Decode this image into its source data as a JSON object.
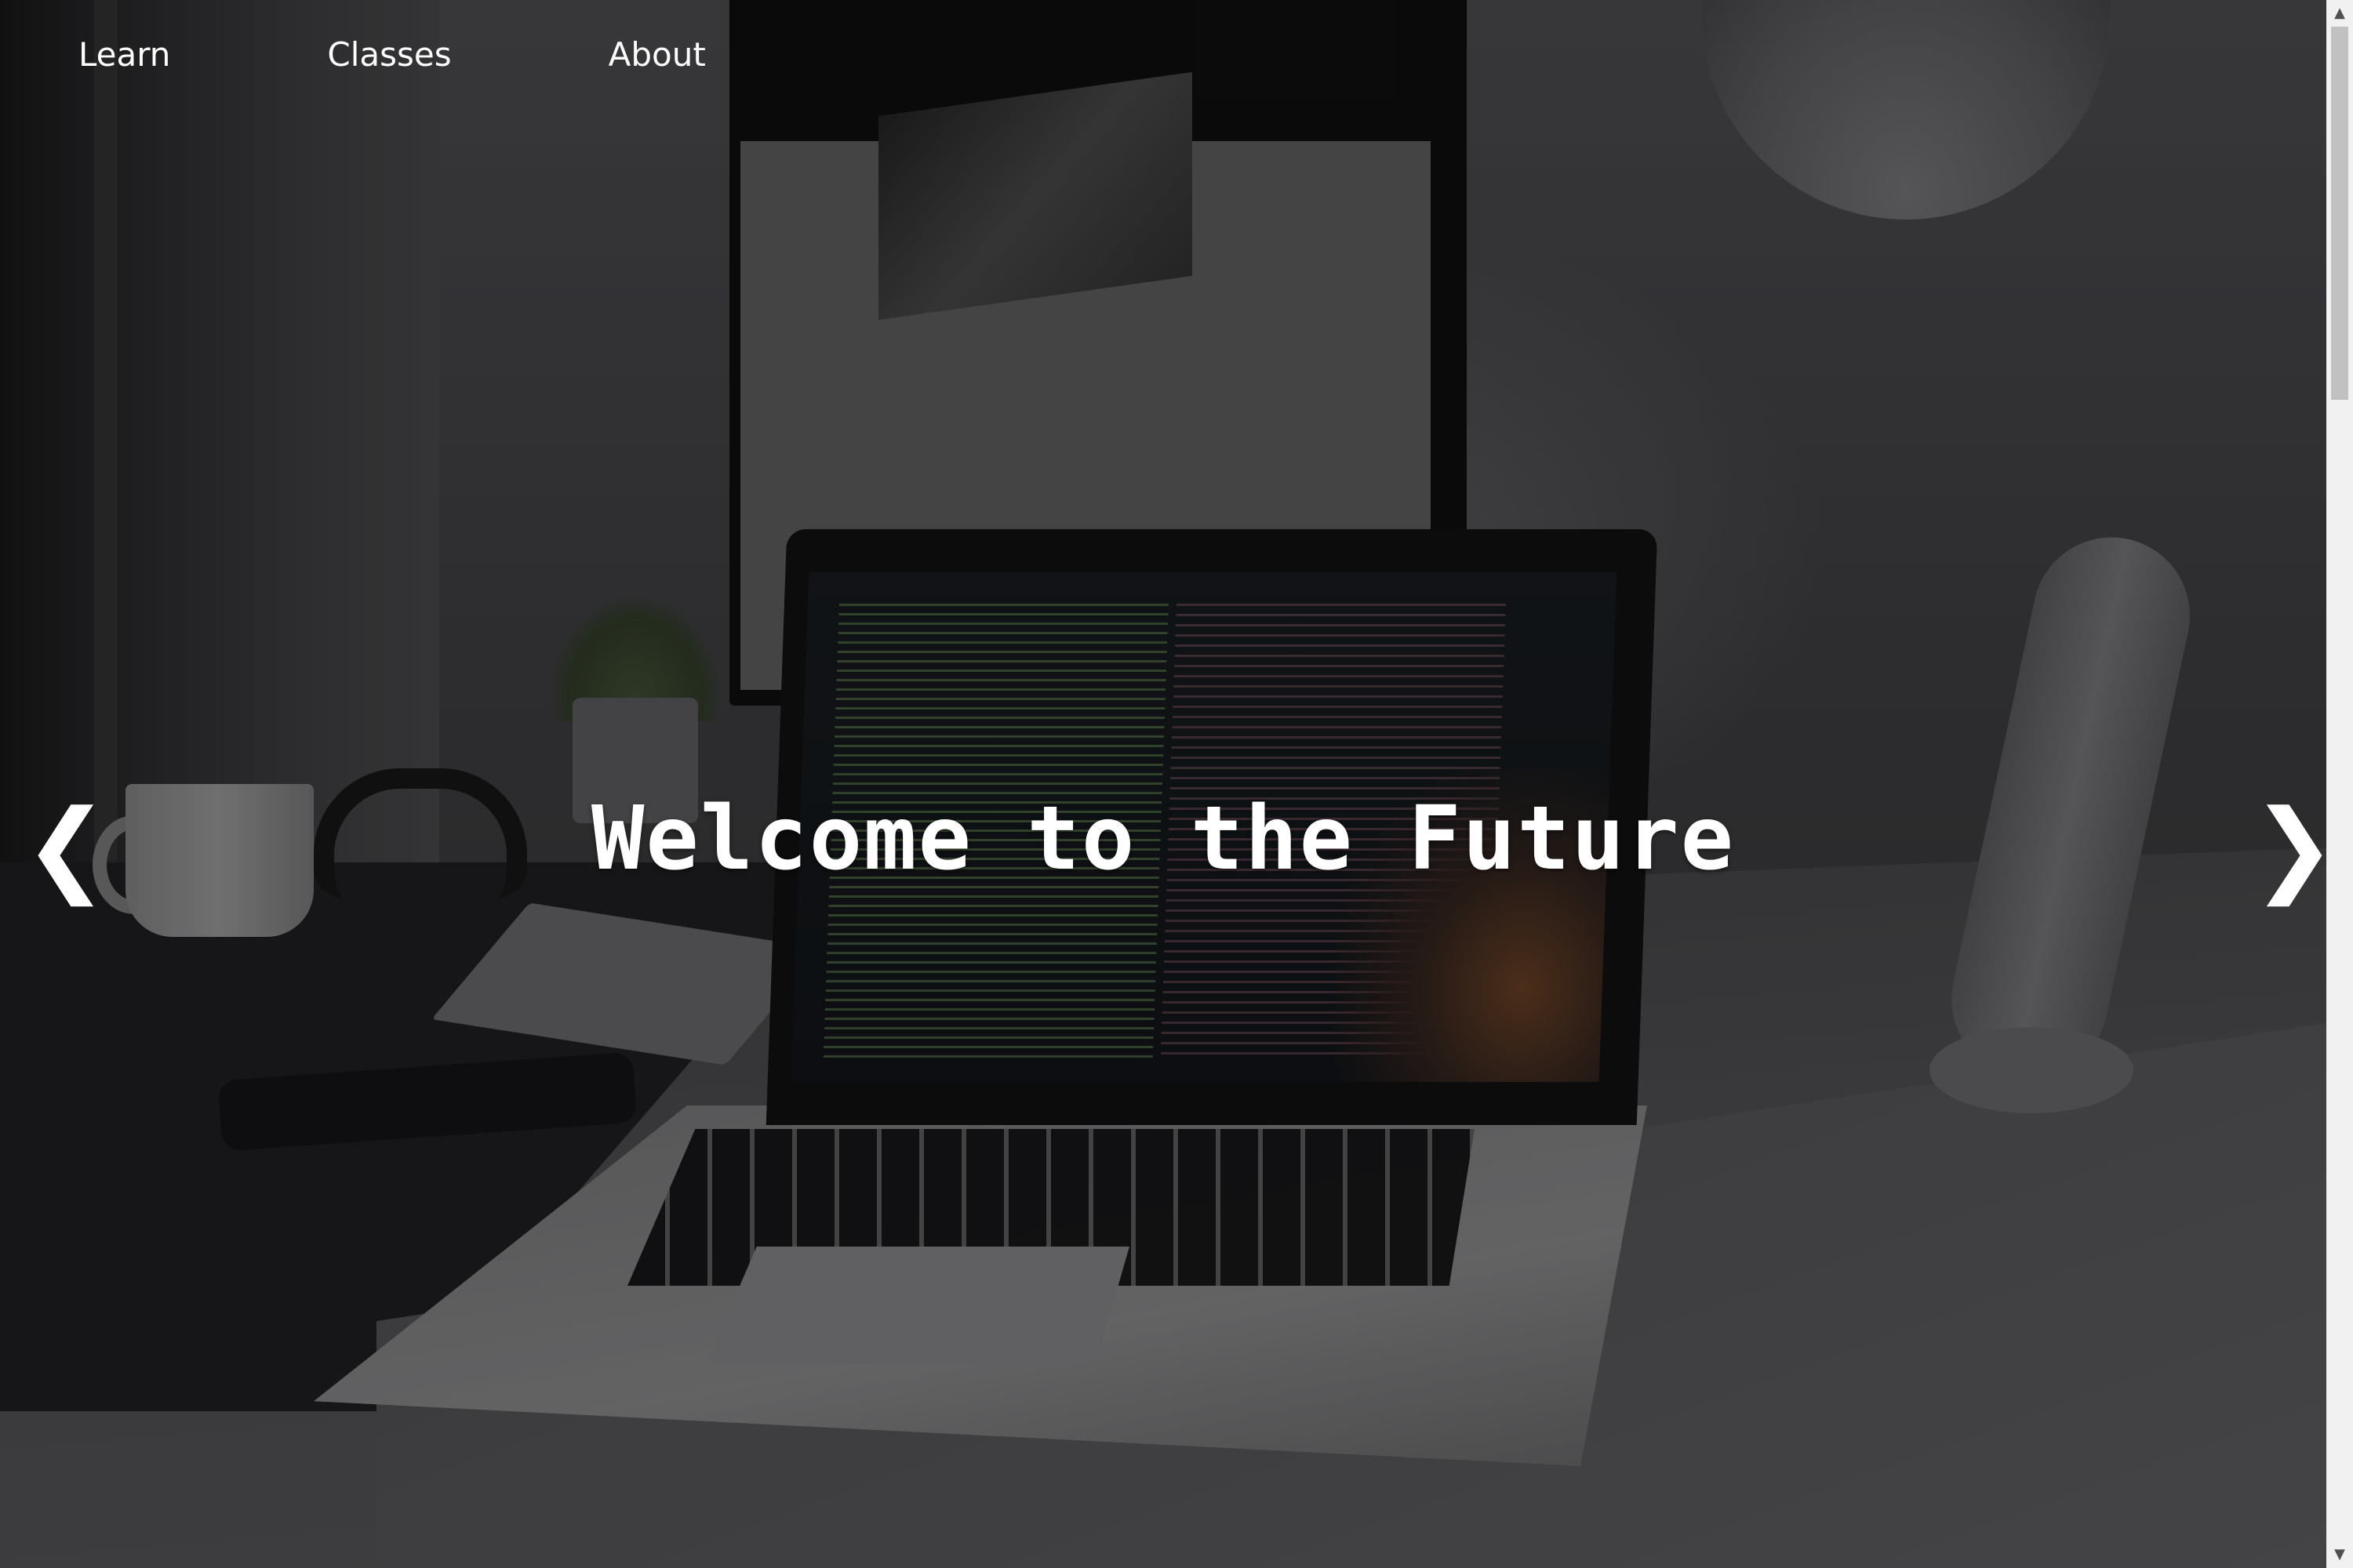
{
  "nav": {
    "items": [
      {
        "label": "Learn"
      },
      {
        "label": "Classes"
      },
      {
        "label": "About"
      }
    ]
  },
  "hero": {
    "headline": "Welcome to the Future",
    "prev_arrow": "❮",
    "next_arrow": "❯"
  },
  "scrollbar": {
    "up_icon": "▲",
    "down_icon": "▼"
  },
  "colors": {
    "text": "#ffffff",
    "overlay": "rgba(0,0,0,0.38)",
    "scrollbar_track": "#f1f1f1",
    "scrollbar_thumb": "#c1c1c1"
  }
}
